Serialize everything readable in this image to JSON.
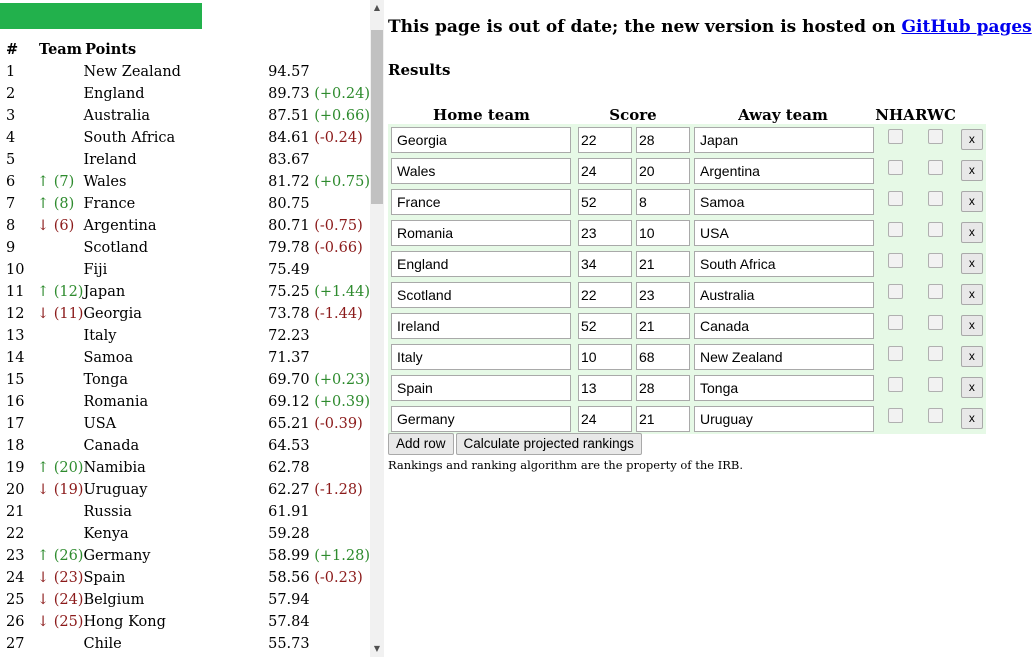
{
  "rankings": {
    "headers": {
      "pos": "#",
      "team": "Team",
      "points": "Points"
    },
    "rows": [
      {
        "pos": "1",
        "move": "",
        "dir": "",
        "team": "New Zealand",
        "points": "94.57",
        "delta": "",
        "ddir": ""
      },
      {
        "pos": "2",
        "move": "",
        "dir": "",
        "team": "England",
        "points": "89.73",
        "delta": "(+0.24)",
        "ddir": "up"
      },
      {
        "pos": "3",
        "move": "",
        "dir": "",
        "team": "Australia",
        "points": "87.51",
        "delta": "(+0.66)",
        "ddir": "up"
      },
      {
        "pos": "4",
        "move": "",
        "dir": "",
        "team": "South Africa",
        "points": "84.61",
        "delta": "(-0.24)",
        "ddir": "down"
      },
      {
        "pos": "5",
        "move": "",
        "dir": "",
        "team": "Ireland",
        "points": "83.67",
        "delta": "",
        "ddir": ""
      },
      {
        "pos": "6",
        "move": "↑ (7)",
        "dir": "up",
        "team": "Wales",
        "points": "81.72",
        "delta": "(+0.75)",
        "ddir": "up"
      },
      {
        "pos": "7",
        "move": "↑ (8)",
        "dir": "up",
        "team": "France",
        "points": "80.75",
        "delta": "",
        "ddir": ""
      },
      {
        "pos": "8",
        "move": "↓ (6)",
        "dir": "down",
        "team": "Argentina",
        "points": "80.71",
        "delta": "(-0.75)",
        "ddir": "down"
      },
      {
        "pos": "9",
        "move": "",
        "dir": "",
        "team": "Scotland",
        "points": "79.78",
        "delta": "(-0.66)",
        "ddir": "down"
      },
      {
        "pos": "10",
        "move": "",
        "dir": "",
        "team": "Fiji",
        "points": "75.49",
        "delta": "",
        "ddir": ""
      },
      {
        "pos": "11",
        "move": "↑ (12)",
        "dir": "up",
        "team": "Japan",
        "points": "75.25",
        "delta": "(+1.44)",
        "ddir": "up"
      },
      {
        "pos": "12",
        "move": "↓ (11)",
        "dir": "down",
        "team": "Georgia",
        "points": "73.78",
        "delta": "(-1.44)",
        "ddir": "down"
      },
      {
        "pos": "13",
        "move": "",
        "dir": "",
        "team": "Italy",
        "points": "72.23",
        "delta": "",
        "ddir": ""
      },
      {
        "pos": "14",
        "move": "",
        "dir": "",
        "team": "Samoa",
        "points": "71.37",
        "delta": "",
        "ddir": ""
      },
      {
        "pos": "15",
        "move": "",
        "dir": "",
        "team": "Tonga",
        "points": "69.70",
        "delta": "(+0.23)",
        "ddir": "up"
      },
      {
        "pos": "16",
        "move": "",
        "dir": "",
        "team": "Romania",
        "points": "69.12",
        "delta": "(+0.39)",
        "ddir": "up"
      },
      {
        "pos": "17",
        "move": "",
        "dir": "",
        "team": "USA",
        "points": "65.21",
        "delta": "(-0.39)",
        "ddir": "down"
      },
      {
        "pos": "18",
        "move": "",
        "dir": "",
        "team": "Canada",
        "points": "64.53",
        "delta": "",
        "ddir": ""
      },
      {
        "pos": "19",
        "move": "↑ (20)",
        "dir": "up",
        "team": "Namibia",
        "points": "62.78",
        "delta": "",
        "ddir": ""
      },
      {
        "pos": "20",
        "move": "↓ (19)",
        "dir": "down",
        "team": "Uruguay",
        "points": "62.27",
        "delta": "(-1.28)",
        "ddir": "down"
      },
      {
        "pos": "21",
        "move": "",
        "dir": "",
        "team": "Russia",
        "points": "61.91",
        "delta": "",
        "ddir": ""
      },
      {
        "pos": "22",
        "move": "",
        "dir": "",
        "team": "Kenya",
        "points": "59.28",
        "delta": "",
        "ddir": ""
      },
      {
        "pos": "23",
        "move": "↑ (26)",
        "dir": "up",
        "team": "Germany",
        "points": "58.99",
        "delta": "(+1.28)",
        "ddir": "up"
      },
      {
        "pos": "24",
        "move": "↓ (23)",
        "dir": "down",
        "team": "Spain",
        "points": "58.56",
        "delta": "(-0.23)",
        "ddir": "down"
      },
      {
        "pos": "25",
        "move": "↓ (24)",
        "dir": "down",
        "team": "Belgium",
        "points": "57.94",
        "delta": "",
        "ddir": ""
      },
      {
        "pos": "26",
        "move": "↓ (25)",
        "dir": "down",
        "team": "Hong Kong",
        "points": "57.84",
        "delta": "",
        "ddir": ""
      },
      {
        "pos": "27",
        "move": "",
        "dir": "",
        "team": "Chile",
        "points": "55.73",
        "delta": "",
        "ddir": ""
      }
    ]
  },
  "notice": {
    "text_before": "This page is out of date; the new version is hosted on ",
    "link_text": "GitHub pages",
    "text_after": "."
  },
  "results": {
    "heading": "Results",
    "headers": {
      "home": "Home team",
      "score": "Score",
      "away": "Away team",
      "nha": "NHA",
      "rwc": "RWC"
    },
    "rows": [
      {
        "home": "Georgia",
        "home_score": "22",
        "away_score": "28",
        "away": "Japan"
      },
      {
        "home": "Wales",
        "home_score": "24",
        "away_score": "20",
        "away": "Argentina"
      },
      {
        "home": "France",
        "home_score": "52",
        "away_score": "8",
        "away": "Samoa"
      },
      {
        "home": "Romania",
        "home_score": "23",
        "away_score": "10",
        "away": "USA"
      },
      {
        "home": "England",
        "home_score": "34",
        "away_score": "21",
        "away": "South Africa"
      },
      {
        "home": "Scotland",
        "home_score": "22",
        "away_score": "23",
        "away": "Australia"
      },
      {
        "home": "Ireland",
        "home_score": "52",
        "away_score": "21",
        "away": "Canada"
      },
      {
        "home": "Italy",
        "home_score": "10",
        "away_score": "68",
        "away": "New Zealand"
      },
      {
        "home": "Spain",
        "home_score": "13",
        "away_score": "28",
        "away": "Tonga"
      },
      {
        "home": "Germany",
        "home_score": "24",
        "away_score": "21",
        "away": "Uruguay"
      }
    ],
    "delete_label": "x",
    "add_row_label": "Add row",
    "calculate_label": "Calculate projected rankings",
    "disclaimer": "Rankings and ranking algorithm are the property of the IRB."
  },
  "scrollbar": {
    "up_glyph": "▲",
    "down_glyph": "▼"
  },
  "colors": {
    "accent_bar": "#22b14c",
    "up": "#2e8b2e",
    "down": "#8b1a1a",
    "results_row_bg": "#e6f9e6",
    "link": "#0000ee"
  }
}
